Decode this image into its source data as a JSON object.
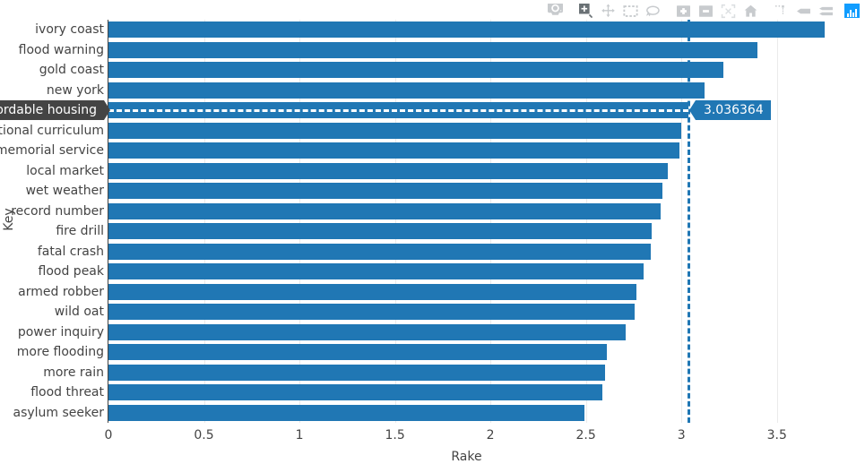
{
  "modebar": {
    "buttons": [
      {
        "name": "download-plot-icon",
        "label": "Download plot as a png"
      },
      {
        "name": "zoom-icon",
        "label": "Zoom"
      },
      {
        "name": "pan-icon",
        "label": "Pan"
      },
      {
        "name": "box-select-icon",
        "label": "Box Select"
      },
      {
        "name": "lasso-select-icon",
        "label": "Lasso Select"
      },
      {
        "name": "zoom-in-icon",
        "label": "Zoom in"
      },
      {
        "name": "zoom-out-icon",
        "label": "Zoom out"
      },
      {
        "name": "autoscale-icon",
        "label": "Autoscale"
      },
      {
        "name": "reset-axes-icon",
        "label": "Reset axes"
      },
      {
        "name": "toggle-spike-lines-icon",
        "label": "Toggle Spike Lines"
      },
      {
        "name": "hover-closest-icon",
        "label": "Show closest data on hover"
      },
      {
        "name": "hover-compare-icon",
        "label": "Compare data on hover"
      },
      {
        "name": "plotly-logo-icon",
        "label": "Produced with Plotly"
      }
    ]
  },
  "chart_data": {
    "type": "bar",
    "orientation": "horizontal",
    "title": "",
    "xlabel": "Rake",
    "ylabel": "Key",
    "xlim": [
      0,
      3.75
    ],
    "xticks": [
      "0",
      "0.5",
      "1",
      "1.5",
      "2",
      "2.5",
      "3",
      "3.5"
    ],
    "xtick_values": [
      0,
      0.5,
      1,
      1.5,
      2,
      2.5,
      3,
      3.5
    ],
    "grid": true,
    "legend": false,
    "bar_color": "#2077b4",
    "categories": [
      "ivory coast",
      "flood warning",
      "gold coast",
      "new york",
      "affordable housing",
      "national curriculum",
      "memorial service",
      "local market",
      "wet weather",
      "record number",
      "fire drill",
      "fatal crash",
      "flood peak",
      "armed robber",
      "wild oat",
      "power inquiry",
      "more flooding",
      "more rain",
      "flood threat",
      "asylum seeker"
    ],
    "values": [
      3.75,
      3.4,
      3.22,
      3.12,
      3.036364,
      3.0,
      2.99,
      2.93,
      2.9,
      2.89,
      2.845,
      2.84,
      2.8,
      2.765,
      2.755,
      2.71,
      2.61,
      2.6,
      2.585,
      2.49
    ]
  },
  "hover": {
    "category_label": "affordable housing",
    "value_label": "3.036364",
    "category_index": 4,
    "spike_color": "#2077b4",
    "label_bg": "#444444"
  }
}
